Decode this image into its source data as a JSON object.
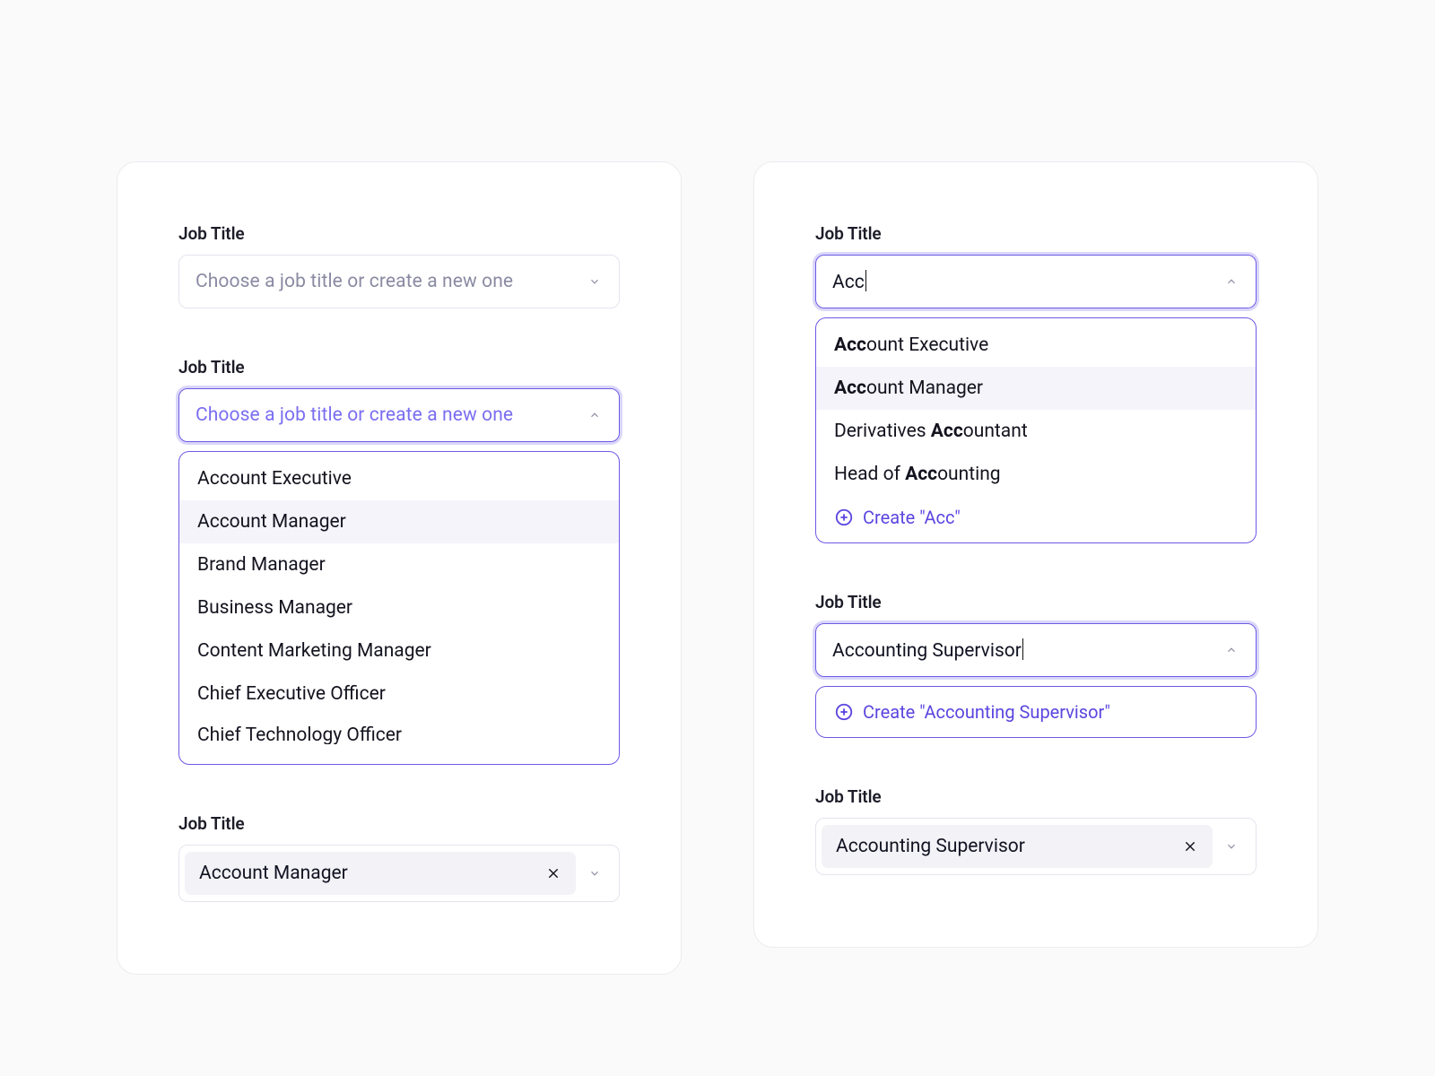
{
  "left": {
    "f1": {
      "label": "Job Title",
      "placeholder": "Choose a job title or create a new one"
    },
    "f2": {
      "label": "Job Title",
      "placeholder": "Choose a job title or create a new one",
      "options": [
        "Account Executive",
        "Account Manager",
        "Brand Manager",
        "Business Manager",
        "Content Marketing Manager",
        "Chief Executive Officer",
        "Chief Technology Officer"
      ]
    },
    "f3": {
      "label": "Job Title",
      "value": "Account Manager"
    }
  },
  "right": {
    "f1": {
      "label": "Job Title",
      "typed": "Acc",
      "options": [
        {
          "pre": "Acc",
          "post": "ount Executive"
        },
        {
          "pre": "Acc",
          "post": "ount Manager"
        },
        {
          "plainpre": "Derivatives ",
          "bold": "Acc",
          "post": "ountant"
        },
        {
          "plainpre": "Head of ",
          "bold": "Acc",
          "post": "ounting"
        }
      ],
      "create": "Create \"Acc\""
    },
    "f2": {
      "label": "Job Title",
      "typed": "Accounting Supervisor",
      "create": "Create \"Accounting Supervisor\""
    },
    "f3": {
      "label": "Job Title",
      "value": "Accounting Supervisor"
    }
  }
}
